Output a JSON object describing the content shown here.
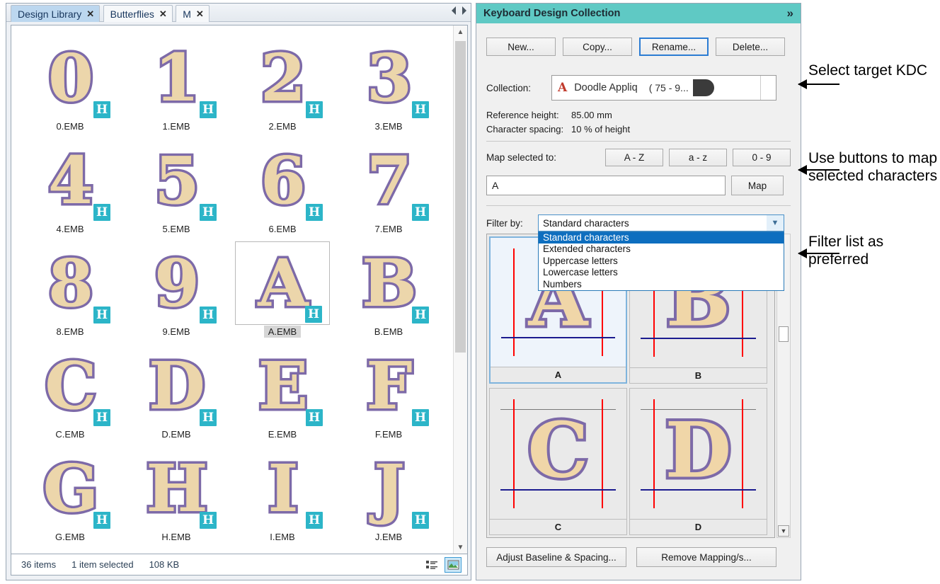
{
  "left_panel": {
    "tabs": [
      {
        "label": "Design Library",
        "close": "✕",
        "active": true
      },
      {
        "label": "Butterflies",
        "close": "✕",
        "active": false
      },
      {
        "label": "M",
        "close": "✕",
        "active": false
      }
    ],
    "nav": {
      "prev": "prev-tab",
      "next": "next-tab"
    },
    "designs": [
      {
        "glyph": "0",
        "label": "0.EMB",
        "badge": "H",
        "selected": false
      },
      {
        "glyph": "1",
        "label": "1.EMB",
        "badge": "H",
        "selected": false
      },
      {
        "glyph": "2",
        "label": "2.EMB",
        "badge": "H",
        "selected": false
      },
      {
        "glyph": "3",
        "label": "3.EMB",
        "badge": "H",
        "selected": false
      },
      {
        "glyph": "4",
        "label": "4.EMB",
        "badge": "H",
        "selected": false
      },
      {
        "glyph": "5",
        "label": "5.EMB",
        "badge": "H",
        "selected": false
      },
      {
        "glyph": "6",
        "label": "6.EMB",
        "badge": "H",
        "selected": false
      },
      {
        "glyph": "7",
        "label": "7.EMB",
        "badge": "H",
        "selected": false
      },
      {
        "glyph": "8",
        "label": "8.EMB",
        "badge": "H",
        "selected": false
      },
      {
        "glyph": "9",
        "label": "9.EMB",
        "badge": "H",
        "selected": false
      },
      {
        "glyph": "A",
        "label": "A.EMB",
        "badge": "H",
        "selected": true
      },
      {
        "glyph": "B",
        "label": "B.EMB",
        "badge": "H",
        "selected": false
      },
      {
        "glyph": "C",
        "label": "C.EMB",
        "badge": "H",
        "selected": false
      },
      {
        "glyph": "D",
        "label": "D.EMB",
        "badge": "H",
        "selected": false
      },
      {
        "glyph": "E",
        "label": "E.EMB",
        "badge": "H",
        "selected": false
      },
      {
        "glyph": "F",
        "label": "F.EMB",
        "badge": "H",
        "selected": false
      },
      {
        "glyph": "G",
        "label": "G.EMB",
        "badge": "H",
        "selected": false
      },
      {
        "glyph": "H",
        "label": "H.EMB",
        "badge": "H",
        "selected": false
      },
      {
        "glyph": "I",
        "label": "I.EMB",
        "badge": "H",
        "selected": false
      },
      {
        "glyph": "J",
        "label": "J.EMB",
        "badge": "H",
        "selected": false
      }
    ],
    "status": {
      "items_count": "36 items",
      "selection": "1 item selected",
      "size": "108 KB",
      "view_details_icon": "details-view-icon",
      "view_thumbnail_icon": "thumbnail-view-icon"
    }
  },
  "right_panel": {
    "title": "Keyboard Design Collection",
    "expand_chevron": "»",
    "top_buttons": [
      {
        "label": "New...",
        "focused": false
      },
      {
        "label": "Copy...",
        "focused": false
      },
      {
        "label": "Rename...",
        "focused": true
      },
      {
        "label": "Delete...",
        "focused": false
      }
    ],
    "collection": {
      "label": "Collection:",
      "icon": "A",
      "name": "Doodle Appliq",
      "range": "( 75 - 9..."
    },
    "reference_height": {
      "key": "Reference height:",
      "value": "85.00 mm"
    },
    "character_spacing": {
      "key": "Character spacing:",
      "value": "10 % of height"
    },
    "map": {
      "label": "Map selected to:",
      "buttons": [
        "A - Z",
        "a - z",
        "0 - 9"
      ],
      "input_value": "A",
      "map_button": "Map"
    },
    "filter": {
      "label": "Filter by:",
      "selected": "Standard characters",
      "options": [
        "Standard characters",
        "Extended characters",
        "Uppercase letters",
        "Lowercase letters",
        "Numbers"
      ]
    },
    "preview_cells": [
      {
        "glyph": "A",
        "label": "A",
        "selected": true,
        "capline": false
      },
      {
        "glyph": "B",
        "label": "B",
        "selected": false,
        "capline": false
      },
      {
        "glyph": "C",
        "label": "C",
        "selected": false,
        "capline": true
      },
      {
        "glyph": "D",
        "label": "D",
        "selected": false,
        "capline": true
      }
    ],
    "bottom_buttons": [
      "Adjust Baseline & Spacing...",
      "Remove Mapping/s..."
    ]
  },
  "annotations": [
    {
      "text": "Select target KDC"
    },
    {
      "text": "Use buttons to map selected characters"
    },
    {
      "text": "Filter list as preferred"
    }
  ],
  "colors": {
    "panel_header": "#5fc9c4",
    "active_tab": "#bcd7ef",
    "focus_border": "#2b7cd3",
    "highlight": "#0d6ebf",
    "badge": "#2cb5c8",
    "stitch_outline": "#7d6aa8",
    "stitch_fill": "#f0d6a8",
    "guide_red": "#ff0000",
    "guide_blue": "#1b1b8f"
  }
}
